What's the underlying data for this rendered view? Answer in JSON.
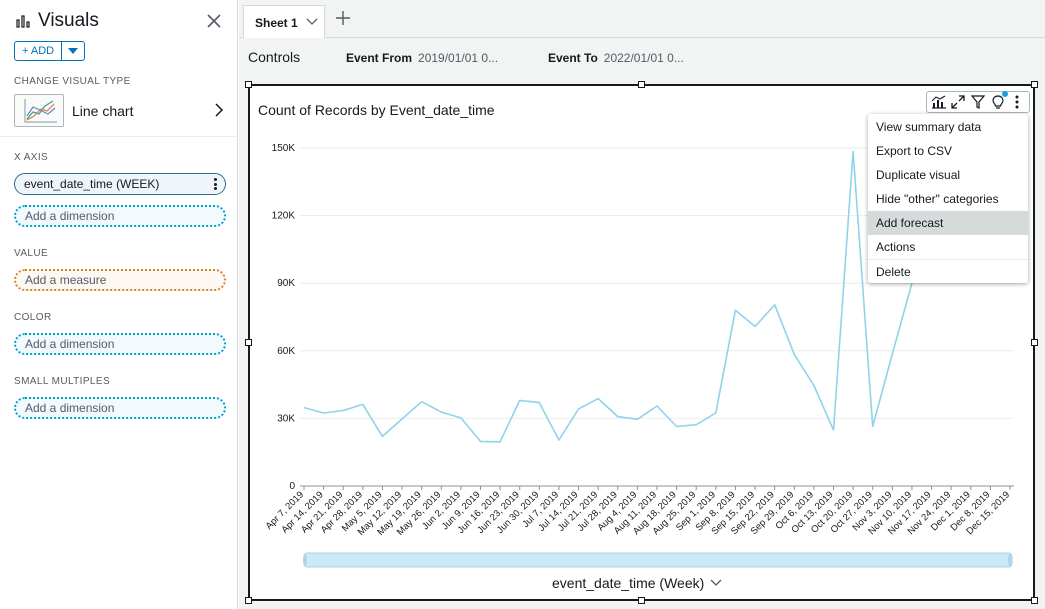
{
  "left_panel": {
    "title": "Visuals",
    "add_button": "+ ADD",
    "change_visual_type_label": "CHANGE VISUAL TYPE",
    "visual_type": "Line chart",
    "x_axis_label": "X AXIS",
    "x_axis_field": "event_date_time (WEEK)",
    "x_axis_placeholder": "Add a dimension",
    "value_label": "VALUE",
    "value_placeholder": "Add a measure",
    "color_label": "COLOR",
    "color_placeholder": "Add a dimension",
    "small_multiples_label": "SMALL MULTIPLES",
    "small_multiples_placeholder": "Add a dimension"
  },
  "tabs": {
    "sheet": "Sheet 1"
  },
  "controls": {
    "title": "Controls",
    "event_from_label": "Event From",
    "event_from_value": "2019/01/01 0...",
    "event_to_label": "Event To",
    "event_to_value": "2022/01/01 0..."
  },
  "visual": {
    "title": "Count of Records by Event_date_time",
    "x_axis_title": "event_date_time (Week)"
  },
  "menu": {
    "items": [
      "View summary data",
      "Export to CSV",
      "Duplicate visual",
      "Hide \"other\" categories",
      "Add forecast",
      "Actions",
      "Delete"
    ],
    "highlighted_index": 4
  },
  "colors": {
    "line": "#8fd3ea",
    "accent": "#0073bb",
    "selection": "#16191f"
  },
  "chart_data": {
    "type": "line",
    "x": [
      "Apr 7, 2019",
      "Apr 14, 2019",
      "Apr 21, 2019",
      "Apr 28, 2019",
      "May 5, 2019",
      "May 12, 2019",
      "May 19, 2019",
      "May 26, 2019",
      "Jun 2, 2019",
      "Jun 9, 2019",
      "Jun 16, 2019",
      "Jun 23, 2019",
      "Jun 30, 2019",
      "Jul 7, 2019",
      "Jul 14, 2019",
      "Jul 21, 2019",
      "Jul 28, 2019",
      "Aug 4, 2019",
      "Aug 11, 2019",
      "Aug 18, 2019",
      "Aug 25, 2019",
      "Sep 1, 2019",
      "Sep 8, 2019",
      "Sep 15, 2019",
      "Sep 22, 2019",
      "Sep 29, 2019",
      "Oct 6, 2019",
      "Oct 13, 2019",
      "Oct 20, 2019",
      "Oct 27, 2019",
      "Nov 3, 2019",
      "Nov 10, 2019",
      "Nov 17, 2019",
      "Nov 24, 2019",
      "Dec 1, 2019",
      "Dec 8, 2019",
      "Dec 15, 2019"
    ],
    "values": [
      34800,
      32400,
      33500,
      36200,
      22000,
      29800,
      37400,
      32800,
      30200,
      19800,
      19600,
      38000,
      37000,
      20400,
      34200,
      38800,
      30800,
      29600,
      35500,
      26400,
      27200,
      32400,
      78000,
      70800,
      80400,
      58400,
      44600,
      24800,
      148500,
      26400,
      58600,
      90000,
      null,
      null,
      null,
      null,
      null
    ],
    "ylim": [
      0,
      150000
    ],
    "yticks": [
      0,
      30000,
      60000,
      90000,
      120000,
      150000
    ],
    "ytick_labels": [
      "0",
      "30K",
      "60K",
      "90K",
      "120K",
      "150K"
    ],
    "grid": true,
    "title": "Count of Records by Event_date_time",
    "xlabel": "event_date_time (Week)"
  }
}
